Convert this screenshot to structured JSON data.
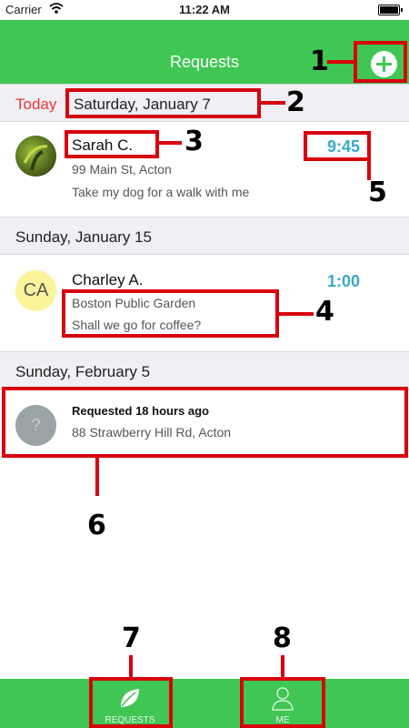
{
  "status_bar": {
    "carrier": "Carrier",
    "time": "11:22 AM"
  },
  "nav": {
    "title": "Requests"
  },
  "sections": [
    {
      "today_label": "Today",
      "date": "Saturday, January 7"
    },
    {
      "date": "Sunday, January 15"
    },
    {
      "date": "Sunday, February 5"
    }
  ],
  "requests": [
    {
      "name": "Sarah C.",
      "address": "99 Main St, Acton",
      "message": "Take my dog for a walk with me",
      "time": "9:45"
    },
    {
      "initials": "CA",
      "name": "Charley A.",
      "place": "Boston Public Garden",
      "message": "Shall we go for coffee?",
      "time": "1:00"
    },
    {
      "avatar_symbol": "?",
      "status": "Requested 18 hours ago",
      "address": "88 Strawberry Hill Rd, Acton"
    }
  ],
  "tabs": [
    {
      "label": "REQUESTS"
    },
    {
      "label": "ME"
    }
  ],
  "callouts": [
    "1",
    "2",
    "3",
    "4",
    "5",
    "6",
    "7",
    "8"
  ],
  "colors": {
    "brand_green": "#3fc654",
    "time_blue": "#3aa9c9",
    "today_red": "#e53935",
    "callout_red": "#d8000c"
  }
}
